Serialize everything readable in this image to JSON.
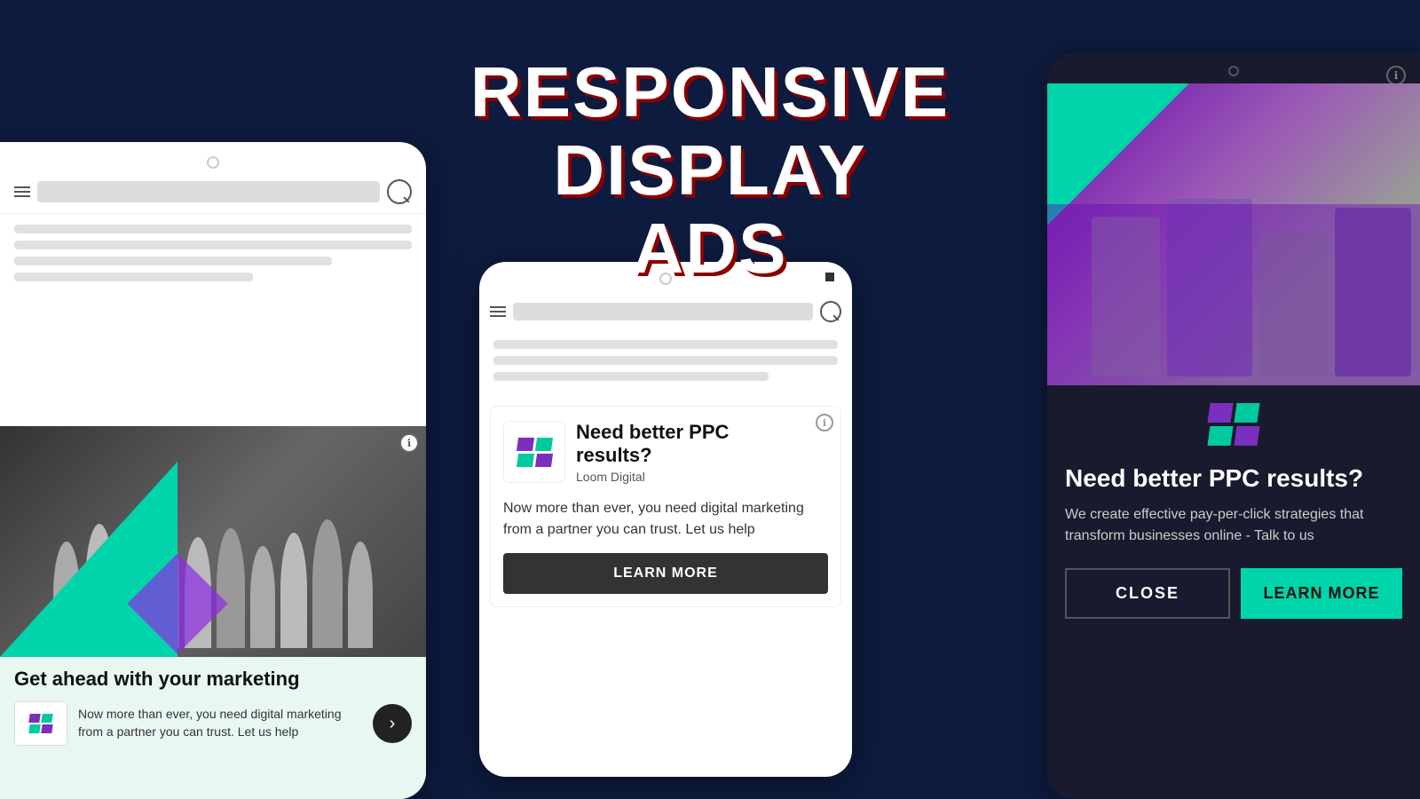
{
  "page": {
    "title_line1": "RESPONSIVE DISPLAY",
    "title_line2": "ADS",
    "background_color": "#0d1b3e"
  },
  "left_phone": {
    "ad": {
      "title": "Get ahead with your marketing",
      "description": "Now more than ever, you need digital marketing from a partner you can trust. Let us help",
      "logo_name": "loom",
      "info_icon": "ℹ",
      "arrow": "›"
    }
  },
  "center_phone": {
    "ad": {
      "title_line1": "Need better PPC",
      "title_line2": "results?",
      "brand": "Loom Digital",
      "body": "Now more than ever, you need digital marketing from a partner you can trust. Let us help",
      "cta_label": "LEARN MORE",
      "info_icon": "ℹ"
    }
  },
  "right_phone": {
    "ad": {
      "title": "Need better PPC results?",
      "description": "We create effective pay-per-click strategies that transform businesses online - Talk to us",
      "close_label": "CLOSE",
      "learn_more_label": "LEARN MORE",
      "info_icon": "ℹ"
    }
  }
}
